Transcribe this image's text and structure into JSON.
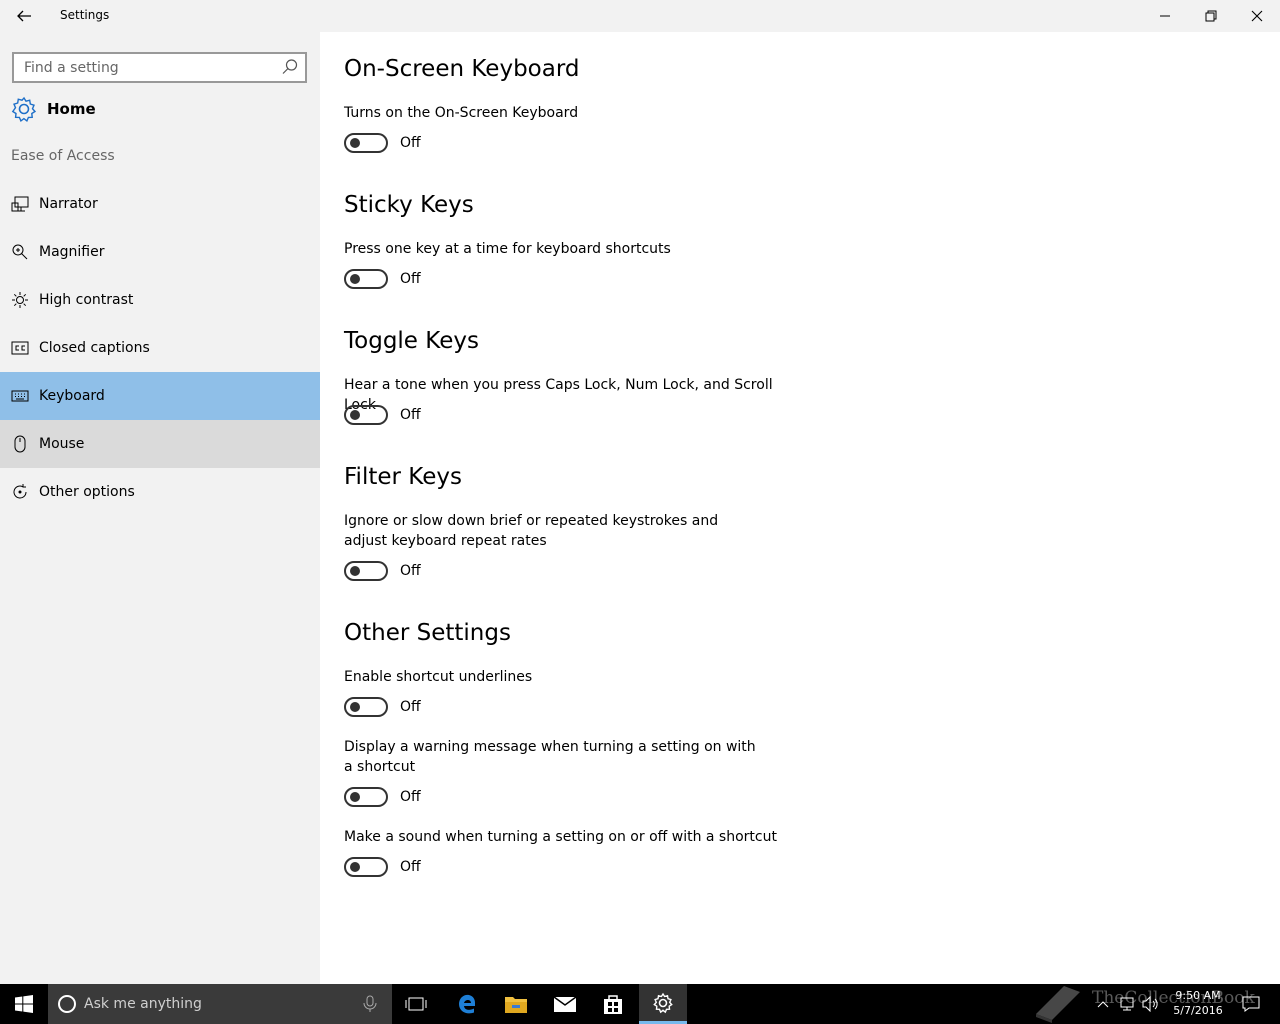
{
  "window": {
    "title": "Settings",
    "back_icon": "back-arrow-icon",
    "controls": [
      "minimize-icon",
      "restore-icon",
      "close-icon"
    ]
  },
  "sidebar": {
    "search_placeholder": "Find a setting",
    "home_label": "Home",
    "section_label": "Ease of Access",
    "items": [
      {
        "label": "Narrator",
        "icon": "narrator-icon"
      },
      {
        "label": "Magnifier",
        "icon": "magnifier-icon"
      },
      {
        "label": "High contrast",
        "icon": "high-contrast-icon"
      },
      {
        "label": "Closed captions",
        "icon": "closed-captions-icon"
      },
      {
        "label": "Keyboard",
        "icon": "keyboard-icon",
        "selected": true
      },
      {
        "label": "Mouse",
        "icon": "mouse-icon",
        "hover": true
      },
      {
        "label": "Other options",
        "icon": "other-options-icon"
      }
    ],
    "selected_color": "#8fbfe8",
    "hover_color": "#dadada"
  },
  "content": {
    "onscreen": {
      "heading": "On-Screen Keyboard",
      "desc": "Turns on the On-Screen Keyboard",
      "state": "Off"
    },
    "sticky": {
      "heading": "Sticky Keys",
      "desc": "Press one key at a time for keyboard shortcuts",
      "state": "Off"
    },
    "togglekeys": {
      "heading": "Toggle Keys",
      "desc": "Hear a tone when you press Caps Lock, Num Lock, and Scroll Lock",
      "state": "Off"
    },
    "filter": {
      "heading": "Filter Keys",
      "desc": "Ignore or slow down brief or repeated keystrokes and adjust keyboard repeat rates",
      "state": "Off"
    },
    "other": {
      "heading": "Other Settings",
      "underlines_desc": "Enable shortcut underlines",
      "underlines_state": "Off",
      "warning_desc": "Display a warning message when turning a setting on with a shortcut",
      "warning_state": "Off",
      "sound_desc": "Make a sound when turning a setting on or off with a shortcut",
      "sound_state": "Off"
    }
  },
  "taskbar": {
    "search_placeholder": "Ask me anything",
    "time": "9:50 AM",
    "date": "5/7/2016",
    "watermark": "TheCollectionBook",
    "apps": [
      "task-view-icon",
      "edge-icon",
      "file-explorer-icon",
      "mail-icon",
      "store-icon",
      "settings-icon"
    ],
    "active_app": "settings-icon",
    "accent": "#76b9ed"
  }
}
